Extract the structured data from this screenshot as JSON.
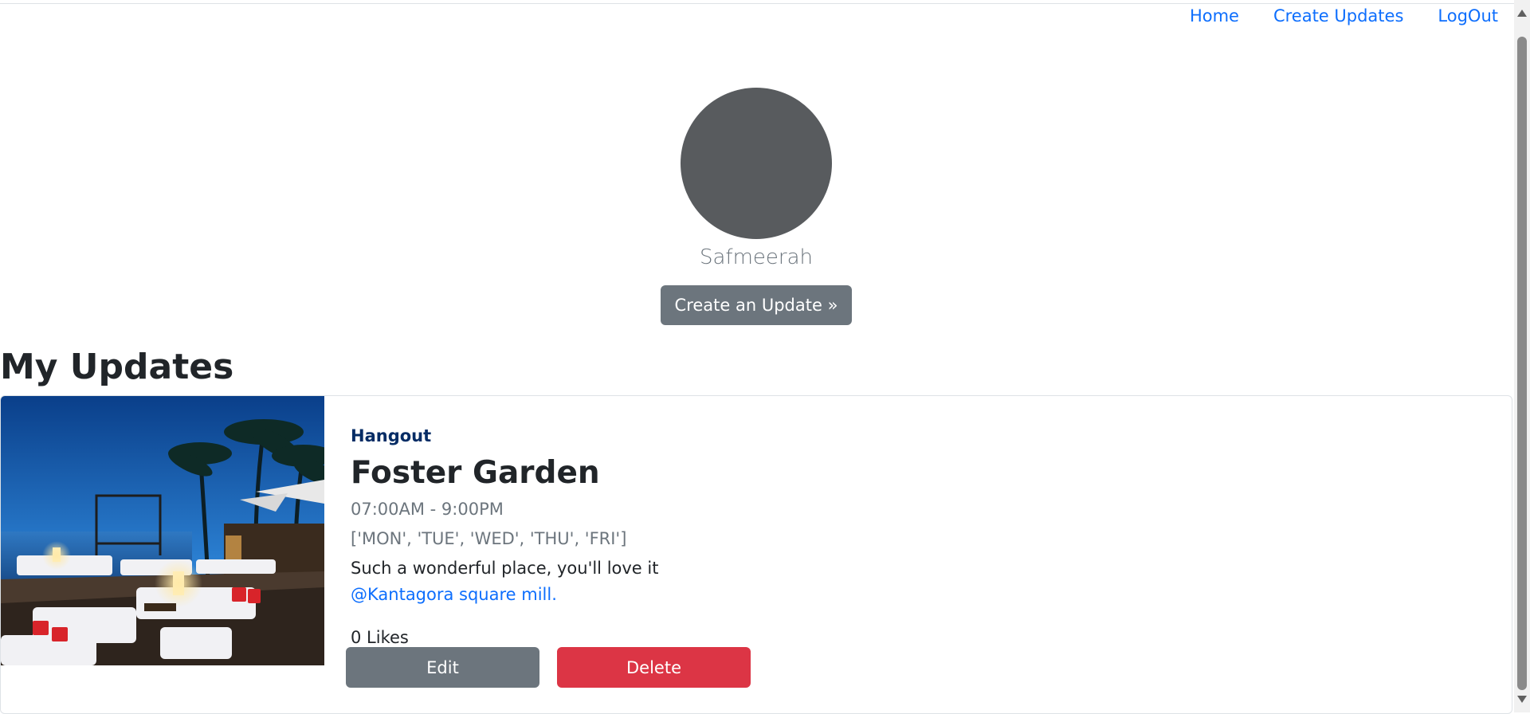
{
  "nav": {
    "home": "Home",
    "create_updates": "Create Updates",
    "logout": "LogOut"
  },
  "profile": {
    "username": "Safmeerah",
    "create_button": "Create an Update »"
  },
  "section_title": "My Updates",
  "updates": [
    {
      "category": "Hangout",
      "name": "Foster Garden",
      "hours": "07:00AM - 9:00PM",
      "days": "['MON', 'TUE', 'WED', 'THU', 'FRI']",
      "description": "Such a wonderful place, you'll love it",
      "location": "@Kantagora square mill.",
      "likes": "0 Likes",
      "edit_label": "Edit",
      "delete_label": "Delete"
    }
  ],
  "colors": {
    "link": "#0d6efd",
    "secondary": "#6c757d",
    "danger": "#dc3545",
    "avatar": "#585b5e",
    "category": "#052c65"
  }
}
